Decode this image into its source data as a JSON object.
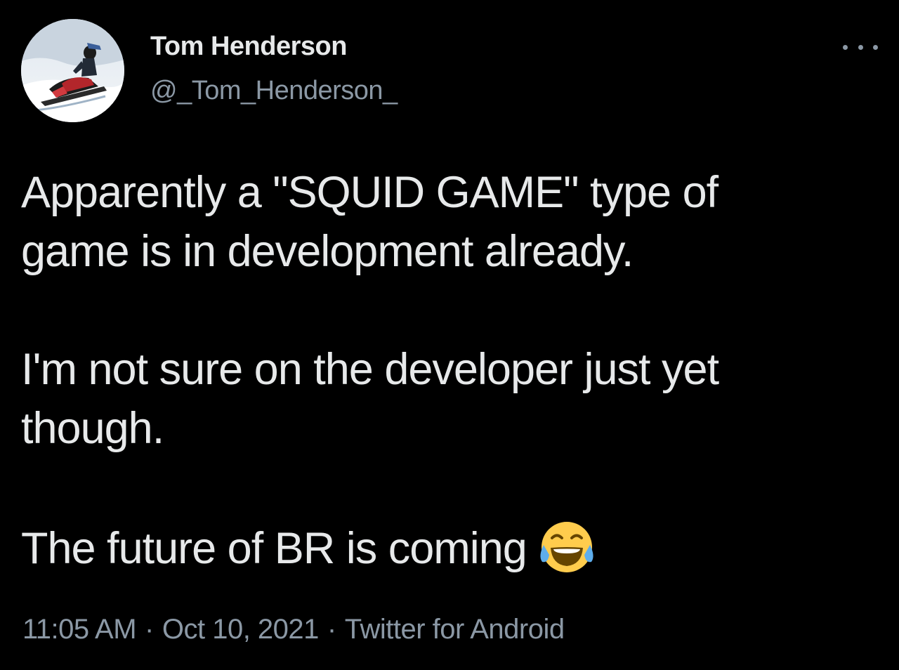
{
  "author": {
    "display_name": "Tom Henderson",
    "handle": "@_Tom_Henderson_",
    "avatar_icon": "snowmobile-avatar"
  },
  "more_icon": "more-horizontal-icon",
  "tweet": {
    "lines": [
      "Apparently a \"SQUID GAME\" type of",
      "game is in development already.",
      "I'm not sure on the developer just yet",
      "though.",
      "The future of BR is coming"
    ],
    "emoji": "face-with-tears-of-joy-icon"
  },
  "meta": {
    "time": "11:05 AM",
    "date": "Oct 10, 2021",
    "separator": "·",
    "source": "Twitter for Android"
  },
  "colors": {
    "background": "#000000",
    "primary_text": "#e7e9ea",
    "secondary_text": "#8b98a5"
  }
}
